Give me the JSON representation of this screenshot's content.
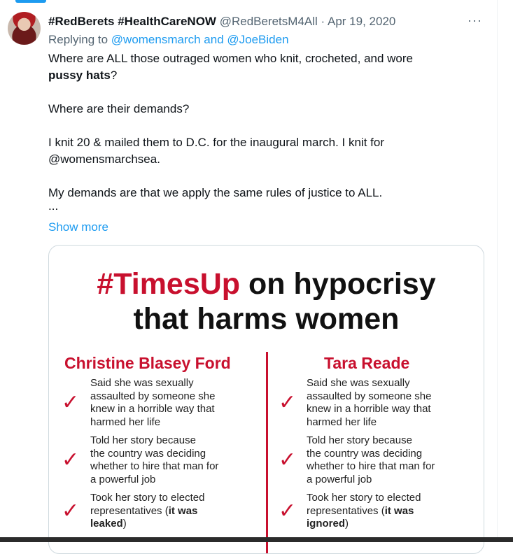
{
  "tweet": {
    "display_name": "#RedBerets #HealthCareNOW",
    "handle": "@RedBeretsM4All",
    "separator": "·",
    "date": "Apr 19, 2020",
    "more_icon": "more-horizontal-icon",
    "more_glyph": "···",
    "replying_prefix": "Replying to ",
    "replying_mentions": "@womensmarch and @JoeBiden",
    "line1a": "Where are ALL those outraged women who knit, crocheted, and wore",
    "line1b_bold": "pussy hats",
    "line1b_tail": "?",
    "line2": "Where are their demands?",
    "line3a": "I knit 20 & mailed them to D.C. for the inaugural march. I knit for",
    "line3b": "@womensmarchsea.",
    "line4": "My demands are that we apply the same rules of justice to ALL.",
    "ellipsis": "...",
    "show_more": "Show more"
  },
  "poster": {
    "title_hash": "#TimesUp",
    "title_rest": " on hypocrisy",
    "title_line2": "that harms women",
    "check_glyph": "✓",
    "left_heading": "Christine Blasey Ford",
    "right_heading": "Tara Reade",
    "left_items": [
      {
        "l1": "Said she was sexually",
        "l2": "assaulted by someone she",
        "l3": "knew in a horrible way that",
        "l4": "harmed her life"
      },
      {
        "l1": "Told her story because",
        "l2": "the country was deciding",
        "l3": "whether to hire that man for",
        "l4": "a powerful job"
      },
      {
        "l1": "Took her story to elected",
        "l2a": "representatives (",
        "l2b": "it was",
        "l3b": "leaked",
        "l3c": ")"
      }
    ],
    "right_items": [
      {
        "l1": "Said she was sexually",
        "l2": "assaulted by someone she",
        "l3": "knew in a horrible way that",
        "l4": "harmed her life"
      },
      {
        "l1": "Told her story because",
        "l2": "the country was deciding",
        "l3": "whether to hire that man for",
        "l4": "a powerful job"
      },
      {
        "l1": "Took her story to elected",
        "l2a": "representatives (",
        "l2b": "it was",
        "l3b": "ignored",
        "l3c": ")"
      }
    ]
  },
  "colors": {
    "accent": "#1d9bf0",
    "poster_red": "#c8102e",
    "text": "#0f1419",
    "muted": "#536471"
  }
}
